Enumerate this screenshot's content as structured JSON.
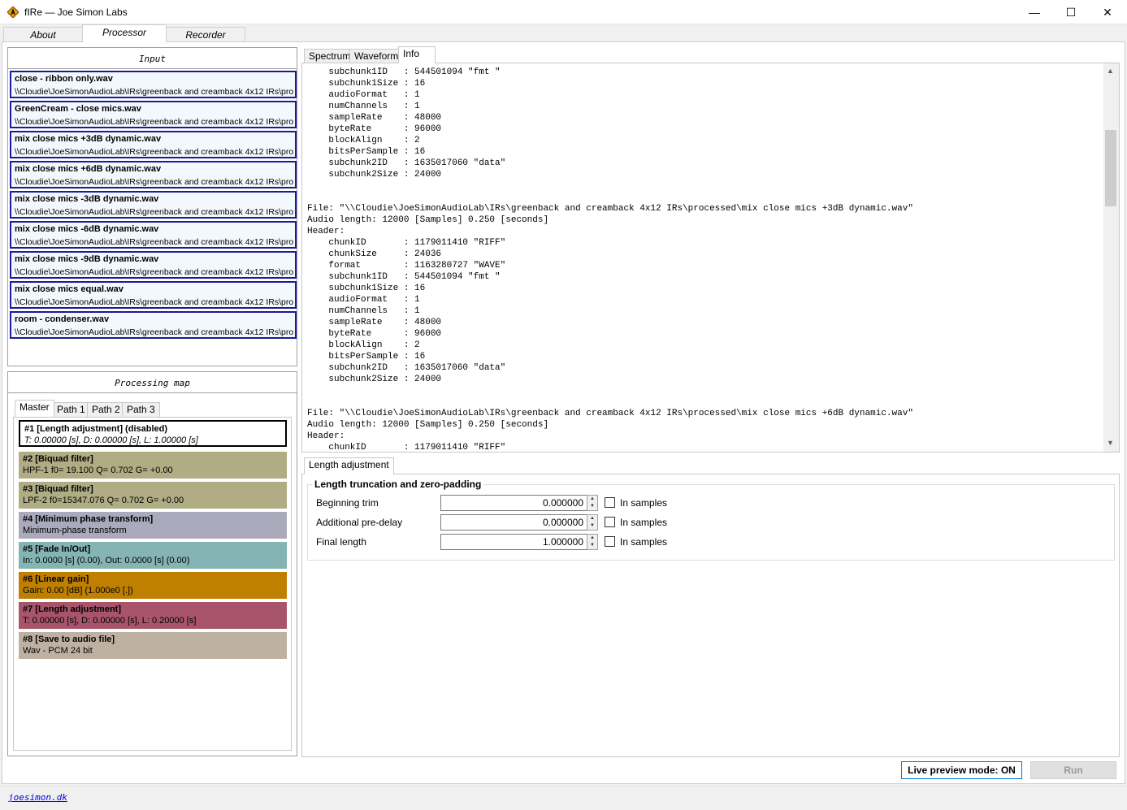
{
  "window": {
    "title": "fIRe — Joe Simon Labs",
    "controls": {
      "minimize": "—",
      "maximize": "☐",
      "close": "✕"
    }
  },
  "main_tabs": [
    {
      "label": "About"
    },
    {
      "label": "Processor"
    },
    {
      "label": "Recorder"
    }
  ],
  "input": {
    "title": "Input",
    "files": [
      {
        "name": "close - ribbon only.wav",
        "path": "\\\\Cloudie\\JoeSimonAudioLab\\IRs\\greenback and creamback 4x12 IRs\\pro"
      },
      {
        "name": "GreenCream - close mics.wav",
        "path": "\\\\Cloudie\\JoeSimonAudioLab\\IRs\\greenback and creamback 4x12 IRs\\pro"
      },
      {
        "name": "mix close mics +3dB dynamic.wav",
        "path": "\\\\Cloudie\\JoeSimonAudioLab\\IRs\\greenback and creamback 4x12 IRs\\pro"
      },
      {
        "name": "mix close mics +6dB dynamic.wav",
        "path": "\\\\Cloudie\\JoeSimonAudioLab\\IRs\\greenback and creamback 4x12 IRs\\pro"
      },
      {
        "name": "mix close mics -3dB dynamic.wav",
        "path": "\\\\Cloudie\\JoeSimonAudioLab\\IRs\\greenback and creamback 4x12 IRs\\pro"
      },
      {
        "name": "mix close mics -6dB dynamic.wav",
        "path": "\\\\Cloudie\\JoeSimonAudioLab\\IRs\\greenback and creamback 4x12 IRs\\pro"
      },
      {
        "name": "mix close mics -9dB dynamic.wav",
        "path": "\\\\Cloudie\\JoeSimonAudioLab\\IRs\\greenback and creamback 4x12 IRs\\pro"
      },
      {
        "name": "mix close mics equal.wav",
        "path": "\\\\Cloudie\\JoeSimonAudioLab\\IRs\\greenback and creamback 4x12 IRs\\pro"
      },
      {
        "name": "room - condenser.wav",
        "path": "\\\\Cloudie\\JoeSimonAudioLab\\IRs\\greenback and creamback 4x12 IRs\\pro"
      }
    ]
  },
  "processing_map": {
    "title": "Processing map",
    "tabs": [
      {
        "label": "Master"
      },
      {
        "label": "Path 1"
      },
      {
        "label": "Path 2"
      },
      {
        "label": "Path 3"
      }
    ],
    "items": [
      {
        "title": "#1   [Length adjustment] (disabled)",
        "desc": "T: 0.00000 [s], D: 0.00000 [s], L: 1.00000 [s]",
        "color": "#ffffff"
      },
      {
        "title": "#2   [Biquad filter]",
        "desc": "HPF-1  f0=    19.100  Q= 0.702  G= +0.00",
        "color": "#b0ac84"
      },
      {
        "title": "#3   [Biquad filter]",
        "desc": "LPF-2  f0=15347.076  Q= 0.702  G= +0.00",
        "color": "#b0ac84"
      },
      {
        "title": "#4   [Minimum phase transform]",
        "desc": "Minimum-phase transform",
        "color": "#aaaabc"
      },
      {
        "title": "#5   [Fade In/Out]",
        "desc": "In: 0.0000 [s] (0.00), Out: 0.0000 [s] (0.00)",
        "color": "#84b4b4"
      },
      {
        "title": "#6   [Linear gain]",
        "desc": "Gain: 0.00 [dB]  (1.000e0 [.])",
        "color": "#bf7f00"
      },
      {
        "title": "#7   [Length adjustment]",
        "desc": "T: 0.00000 [s], D: 0.00000 [s], L: 0.20000 [s]",
        "color": "#a8556c"
      },
      {
        "title": "#8   [Save to audio file]",
        "desc": "Wav - PCM 24 bit",
        "color": "#bfb1a1"
      }
    ]
  },
  "view_tabs": [
    {
      "label": "Spectrum"
    },
    {
      "label": "Waveform"
    },
    {
      "label": "Info"
    }
  ],
  "info_text": "    subchunk1ID   : 544501094 \"fmt \"\n    subchunk1Size : 16\n    audioFormat   : 1\n    numChannels   : 1\n    sampleRate    : 48000\n    byteRate      : 96000\n    blockAlign    : 2\n    bitsPerSample : 16\n    subchunk2ID   : 1635017060 \"data\"\n    subchunk2Size : 24000\n\n\nFile: \"\\\\Cloudie\\JoeSimonAudioLab\\IRs\\greenback and creamback 4x12 IRs\\processed\\mix close mics +3dB dynamic.wav\"\nAudio length: 12000 [Samples] 0.250 [seconds]\nHeader:\n    chunkID       : 1179011410 \"RIFF\"\n    chunkSize     : 24036\n    format        : 1163280727 \"WAVE\"\n    subchunk1ID   : 544501094 \"fmt \"\n    subchunk1Size : 16\n    audioFormat   : 1\n    numChannels   : 1\n    sampleRate    : 48000\n    byteRate      : 96000\n    blockAlign    : 2\n    bitsPerSample : 16\n    subchunk2ID   : 1635017060 \"data\"\n    subchunk2Size : 24000\n\n\nFile: \"\\\\Cloudie\\JoeSimonAudioLab\\IRs\\greenback and creamback 4x12 IRs\\processed\\mix close mics +6dB dynamic.wav\"\nAudio length: 12000 [Samples] 0.250 [seconds]\nHeader:\n    chunkID       : 1179011410 \"RIFF\"",
  "settings": {
    "tab_label": "Length adjustment",
    "group_title": "Length truncation and zero-padding",
    "rows": [
      {
        "label": "Beginning trim",
        "value": "0.000000",
        "checkbox_label": "In samples"
      },
      {
        "label": "Additional pre-delay",
        "value": "0.000000",
        "checkbox_label": "In samples"
      },
      {
        "label": "Final length",
        "value": "1.000000",
        "checkbox_label": "In samples"
      }
    ]
  },
  "bottom": {
    "live_preview": "Live preview mode: ON",
    "run": "Run"
  },
  "footer": {
    "link": "joesimon.dk"
  }
}
